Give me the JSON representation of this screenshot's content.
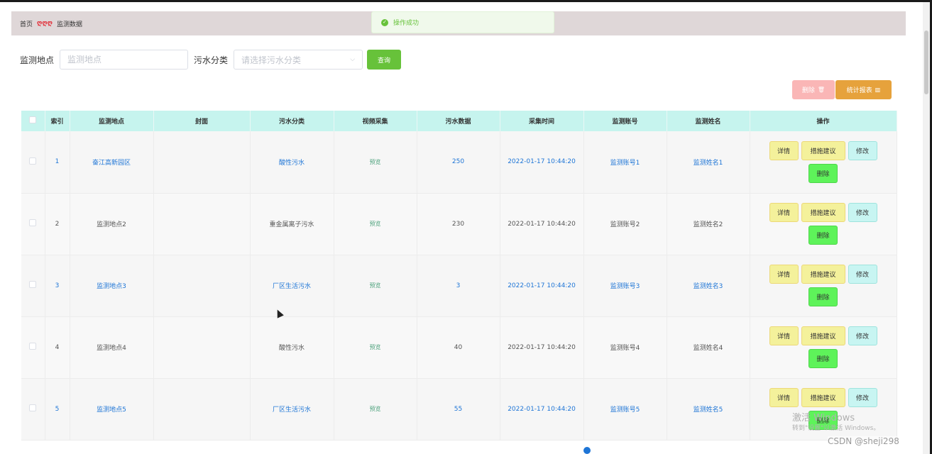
{
  "breadcrumb": {
    "home": "首页",
    "separator": "ღღღ",
    "current": "监测数据"
  },
  "toast": {
    "message": "操作成功"
  },
  "search": {
    "location_label": "监测地点",
    "location_placeholder": "监测地点",
    "category_label": "污水分类",
    "category_placeholder": "请选择污水分类",
    "query_label": "查询"
  },
  "actions": {
    "delete_label": "删除",
    "report_label": "统计报表"
  },
  "table": {
    "headers": [
      "索引",
      "监测地点",
      "封面",
      "污水分类",
      "视频采集",
      "污水数据",
      "采集时间",
      "监测账号",
      "监测姓名",
      "操作"
    ],
    "rows": [
      {
        "index": "1",
        "location": "奋江高新园区",
        "category": "酸性污水",
        "video": "预览",
        "value": "250",
        "time": "2022-01-17 10:44:20",
        "account": "监测账号1",
        "name": "监测姓名1"
      },
      {
        "index": "2",
        "location": "监测地点2",
        "category": "重金属离子污水",
        "video": "预览",
        "value": "230",
        "time": "2022-01-17 10:44:20",
        "account": "监测账号2",
        "name": "监测姓名2"
      },
      {
        "index": "3",
        "location": "监测地点3",
        "category": "厂区生活污水",
        "video": "预览",
        "value": "3",
        "time": "2022-01-17 10:44:20",
        "account": "监测账号3",
        "name": "监测姓名3"
      },
      {
        "index": "4",
        "location": "监测地点4",
        "category": "酸性污水",
        "video": "预览",
        "value": "40",
        "time": "2022-01-17 10:44:20",
        "account": "监测账号4",
        "name": "监测姓名4"
      },
      {
        "index": "5",
        "location": "监测地点5",
        "category": "厂区生活污水",
        "video": "预览",
        "value": "55",
        "time": "2022-01-17 10:44:20",
        "account": "监测账号5",
        "name": "监测姓名5"
      }
    ],
    "row_ops": {
      "detail": "详情",
      "suggest": "措施建议",
      "edit": "修改",
      "delete": "删除"
    }
  },
  "overlay": {
    "watermark": "激活 Windows",
    "watermark_sub": "转到\"设置\"以激活 Windows。",
    "csdn": "CSDN @sheji298"
  },
  "colors": {
    "primary_green": "#67c23a",
    "link_blue": "#1e75d6",
    "header_bg": "#c6f4ee",
    "warning": "#e6a23c",
    "danger_light": "#fab6b6"
  }
}
